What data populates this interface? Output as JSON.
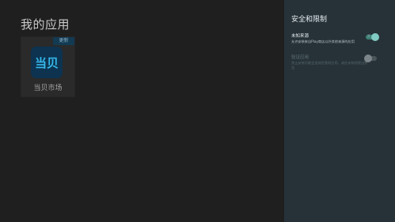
{
  "main": {
    "title": "我的应用",
    "apps": [
      {
        "name": "当贝市场",
        "badge": "更新",
        "icon_text": "当贝",
        "icon": "dangbei-market-icon"
      }
    ]
  },
  "panel": {
    "title": "安全和限制",
    "settings": [
      {
        "title": "未知来源",
        "description": "允许安装来自Play商店以外其他来源的应用",
        "state": "on",
        "state_label": "开"
      },
      {
        "title": "验证应用",
        "description": "禁止安装可能会造成危害的应用，或在安装前提出警告",
        "state": "off"
      }
    ]
  },
  "colors": {
    "accent": "#80cbc4",
    "panel_bg": "#263238",
    "main_bg": "#1f1f1f",
    "app_icon_bg": "#0d3350"
  }
}
